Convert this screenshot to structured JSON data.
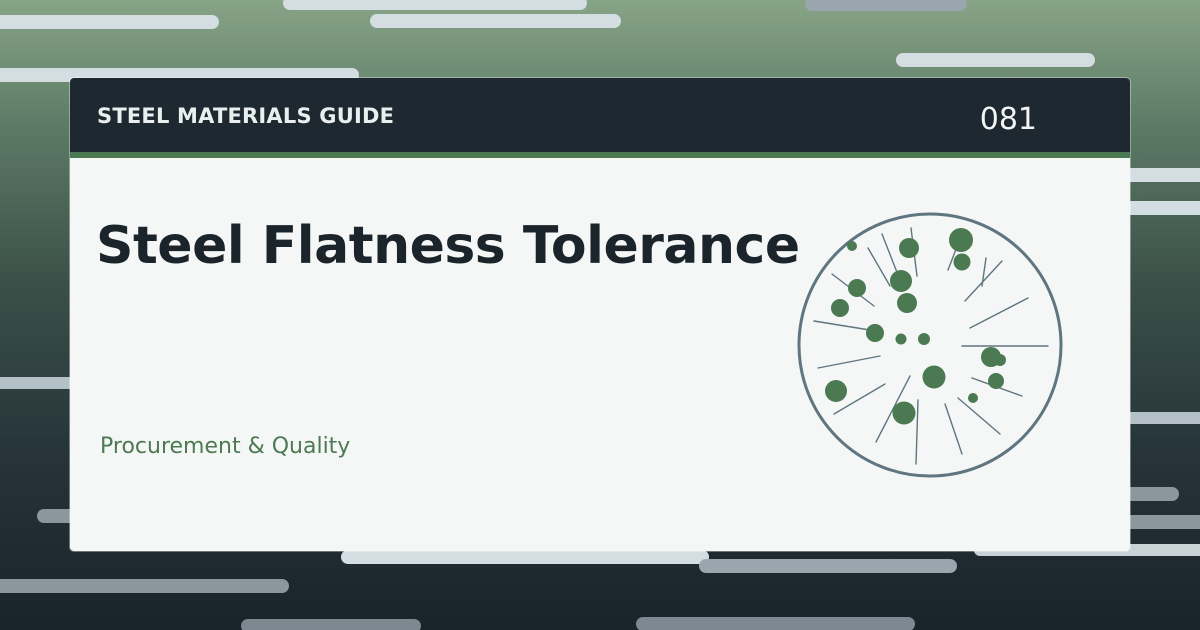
{
  "header": {
    "series_title": "STEEL MATERIALS GUIDE",
    "issue_number": "081"
  },
  "main": {
    "title": "Steel Flatness Tolerance",
    "category": "Procurement & Quality"
  },
  "colors": {
    "accent": "#4b7a52",
    "header_background": "#1e2831",
    "card_background": "#f4f7f6",
    "title_text": "#1b242b",
    "emblem_stroke": "#5f7580"
  },
  "icons": {
    "emblem": "steel-grain-circle-icon"
  }
}
